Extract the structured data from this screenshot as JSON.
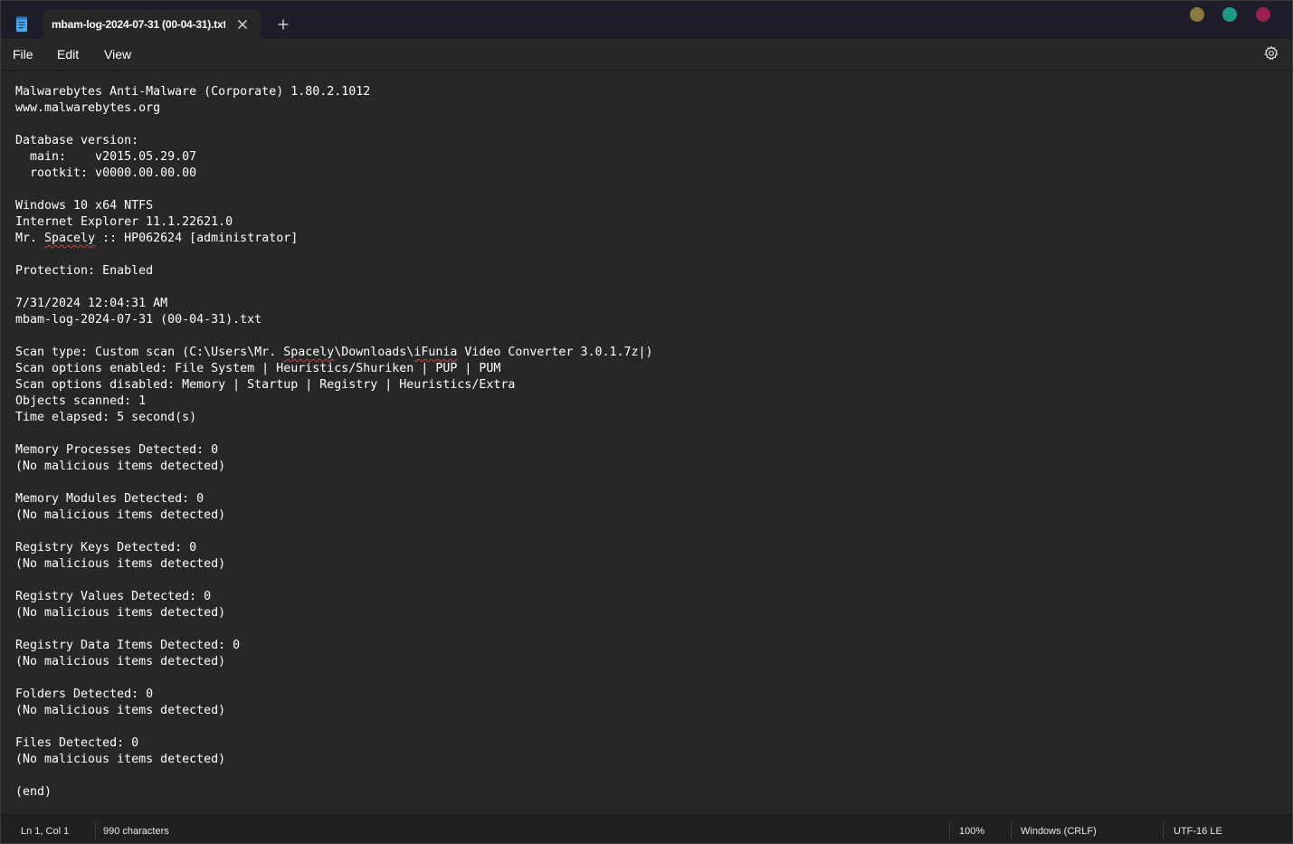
{
  "window": {
    "tab_title": "mbam-log-2024-07-31 (00-04-31).txt",
    "accent_colors": [
      "#8b7a3d",
      "#1e9a82",
      "#9b2050"
    ]
  },
  "icons": {
    "app": "notepad-icon",
    "close": "close-icon",
    "new_tab": "plus-icon",
    "settings": "gear-icon"
  },
  "menu": {
    "file": "File",
    "edit": "Edit",
    "view": "View"
  },
  "editor": {
    "lines": [
      "Malwarebytes Anti-Malware (Corporate) 1.80.2.1012",
      "www.malwarebytes.org",
      "",
      "Database version:",
      "  main:    v2015.05.29.07",
      "  rootkit: v0000.00.00.00",
      "",
      "Windows 10 x64 NTFS",
      "Internet Explorer 11.1.22621.0",
      "Mr. Spacely :: HP062624 [administrator]",
      "",
      "Protection: Enabled",
      "",
      "7/31/2024 12:04:31 AM",
      "mbam-log-2024-07-31 (00-04-31).txt",
      "",
      "Scan type: Custom scan (C:\\Users\\Mr. Spacely\\Downloads\\iFunia Video Converter 3.0.1.7z|)",
      "Scan options enabled: File System | Heuristics/Shuriken | PUP | PUM",
      "Scan options disabled: Memory | Startup | Registry | Heuristics/Extra",
      "Objects scanned: 1",
      "Time elapsed: 5 second(s)",
      "",
      "Memory Processes Detected: 0",
      "(No malicious items detected)",
      "",
      "Memory Modules Detected: 0",
      "(No malicious items detected)",
      "",
      "Registry Keys Detected: 0",
      "(No malicious items detected)",
      "",
      "Registry Values Detected: 0",
      "(No malicious items detected)",
      "",
      "Registry Data Items Detected: 0",
      "(No malicious items detected)",
      "",
      "Folders Detected: 0",
      "(No malicious items detected)",
      "",
      "Files Detected: 0",
      "(No malicious items detected)",
      "",
      "(end)"
    ],
    "misspelled_words": [
      "Spacely",
      "iFunia"
    ]
  },
  "status": {
    "position": "Ln 1, Col 1",
    "characters": "990 characters",
    "zoom": "100%",
    "line_endings": "Windows (CRLF)",
    "encoding": "UTF-16 LE"
  }
}
